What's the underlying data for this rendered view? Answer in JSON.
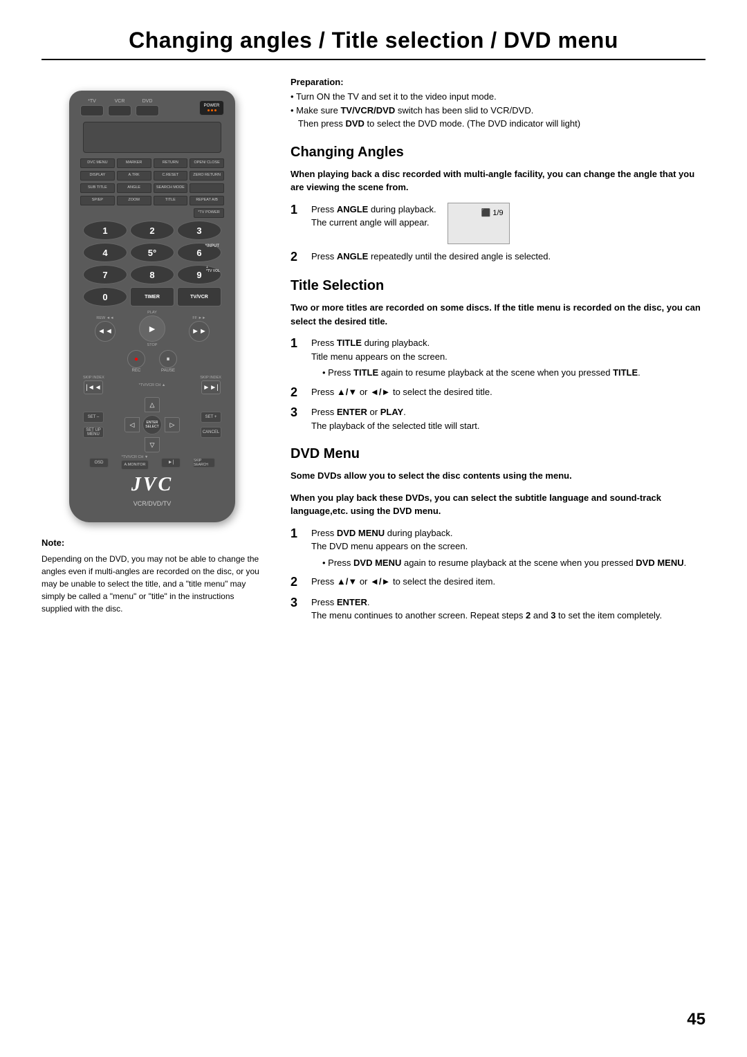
{
  "page": {
    "title": "Changing angles / Title selection / DVD menu",
    "page_number": "45"
  },
  "preparation": {
    "label": "Preparation:",
    "items": [
      "Turn ON the TV and set it to the video input mode.",
      "Make sure TV/VCR/DVD switch has been slid to VCR/DVD.\n    Then press DVD to select the DVD mode. (The DVD indicator will light)"
    ]
  },
  "sections": {
    "changing_angles": {
      "title": "Changing Angles",
      "bold_desc": "When playing back a disc recorded with multi-angle facility, you can change the angle that you are viewing the scene from.",
      "steps": [
        {
          "num": "1",
          "text": "Press ANGLE during playback.",
          "sub": "The current angle will appear.",
          "has_box": true,
          "box_text": "⬛ 1/9"
        },
        {
          "num": "2",
          "text": "Press ANGLE repeatedly until the desired angle is selected."
        }
      ]
    },
    "title_selection": {
      "title": "Title Selection",
      "bold_desc": "Two or more titles are recorded on some discs. If the title menu is recorded on the disc, you can select the desired title.",
      "steps": [
        {
          "num": "1",
          "main": "Press TITLE during playback.",
          "sub1": "Title menu appears on the screen.",
          "sub2": "Press TITLE again to resume playback at the scene when you pressed TITLE."
        },
        {
          "num": "2",
          "text": "Press ▲/▼ or ◄/► to select the desired title."
        },
        {
          "num": "3",
          "main": "Press ENTER or PLAY.",
          "sub1": "The playback of the selected title will start."
        }
      ]
    },
    "dvd_menu": {
      "title": "DVD Menu",
      "bold_desc1": "Some DVDs allow you to select the disc contents using the menu.",
      "bold_desc2": "When you play back these DVDs, you can select the subtitle language and sound-track language,etc. using the DVD menu.",
      "steps": [
        {
          "num": "1",
          "main": "Press DVD MENU during playback.",
          "sub1": "The DVD menu appears on the screen.",
          "sub2": "Press DVD MENU again to resume playback at the scene when you pressed DVD MENU."
        },
        {
          "num": "2",
          "text": "Press ▲/▼ or ◄/► to select the desired item."
        },
        {
          "num": "3",
          "main": "Press ENTER.",
          "sub1": "The menu continues to another screen. Repeat steps 2 and 3 to set the item completely."
        }
      ]
    }
  },
  "note": {
    "title": "Note:",
    "text": "Depending on the DVD, you may not be able to change the angles even if multi-angles are recorded on the disc, or you may be unable to select the title, and a \"title menu\" may simply be called a \"menu\" or \"title\" in the instructions supplied with the disc."
  },
  "remote": {
    "brand": "JVC",
    "model": "VCR/DVD/TV",
    "modes": [
      "*TV",
      "VCR",
      "DVD"
    ],
    "power_label": "POWER",
    "buttons": {
      "row1": [
        "DVC MENU",
        "MARKER",
        "RETURN",
        "OPEN/CLOSE"
      ],
      "row2": [
        "DISPLAY",
        "A.TRK",
        "C.RESET",
        "ZERO RETURN"
      ],
      "row3": [
        "SUB TITLE",
        "ANGLE",
        "SEARCH MODE"
      ],
      "row4": [
        "SP/EP",
        "ZOOM",
        "TITLE",
        "REPEAT A/B"
      ],
      "numbers": [
        "1",
        "2",
        "3",
        "4",
        "5°",
        "6",
        "7",
        "8",
        "9"
      ],
      "num_bottom": [
        "0",
        "TIMER",
        "TV/VCR"
      ],
      "tv_power": "*TV POWER",
      "tv_input": "*INPUT",
      "tv_vol": "*TV VOL"
    }
  }
}
